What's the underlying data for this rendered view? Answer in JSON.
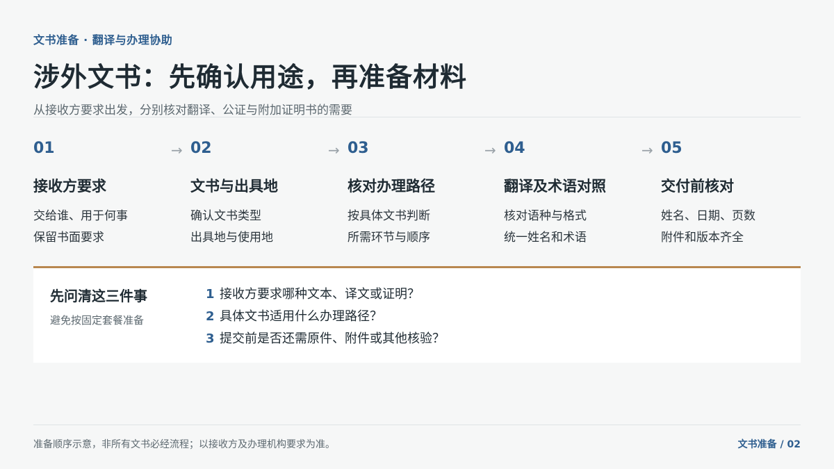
{
  "header": {
    "kicker": "文书准备 · 翻译与办理协助",
    "title": "涉外文书：先确认用途，再准备材料",
    "subtitle": "从接收方要求出发，分别核对翻译、公证与附加证明书的需要"
  },
  "steps": [
    {
      "num": "01",
      "title": "接收方要求",
      "lines": [
        "交给谁、用于何事",
        "保留书面要求"
      ]
    },
    {
      "num": "02",
      "title": "文书与出具地",
      "lines": [
        "确认文书类型",
        "出具地与使用地"
      ]
    },
    {
      "num": "03",
      "title": "核对办理路径",
      "lines": [
        "按具体文书判断",
        "所需环节与顺序"
      ]
    },
    {
      "num": "04",
      "title": "翻译及术语对照",
      "lines": [
        "核对语种与格式",
        "统一姓名和术语"
      ]
    },
    {
      "num": "05",
      "title": "交付前核对",
      "lines": [
        "姓名、日期、页数",
        "附件和版本齐全"
      ]
    }
  ],
  "arrow_glyph": "→",
  "panel": {
    "heading": "先问清这三件事",
    "subheading": "避免按固定套餐准备",
    "questions": [
      {
        "num": "1",
        "text": "接收方要求哪种文本、译文或证明？"
      },
      {
        "num": "2",
        "text": "具体文书适用什么办理路径？"
      },
      {
        "num": "3",
        "text": "提交前是否还需原件、附件或其他核验？"
      }
    ]
  },
  "footer": {
    "note": "准备顺序示意，非所有文书必经流程；以接收方及办理机构要求为准。",
    "page": "文书准备 / 02"
  },
  "colors": {
    "accent": "#2e5e8f",
    "rule_gold": "#b8874f",
    "background": "#f6f7f7"
  }
}
